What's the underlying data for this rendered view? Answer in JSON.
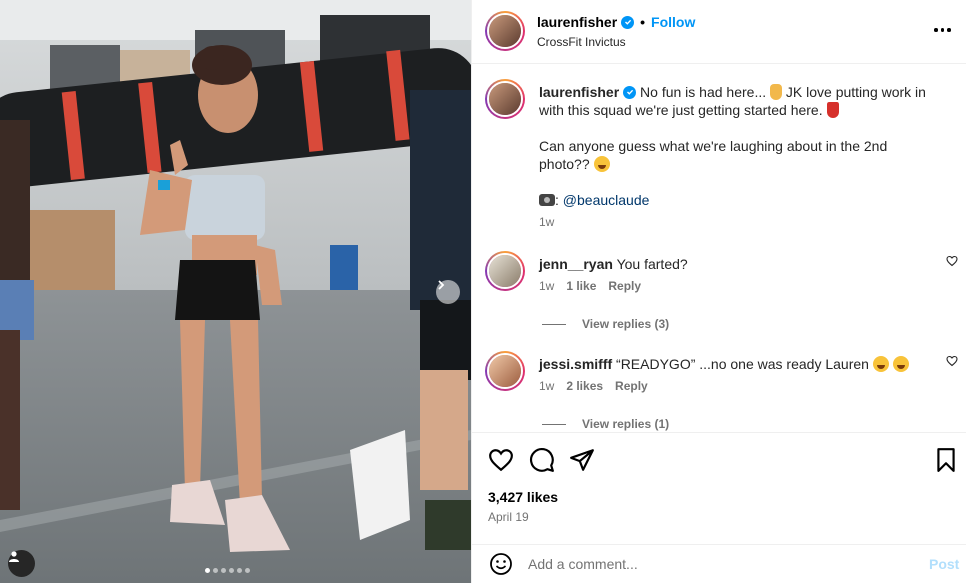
{
  "post": {
    "username": "laurenfisher",
    "follow_label": "Follow",
    "location": "CrossFit Invictus",
    "dot": "•",
    "carousel": {
      "slide_count": 6,
      "active_index": 0
    }
  },
  "caption": {
    "username": "laurenfisher",
    "line1": "No fun is had here... ",
    "line1b": " JK love putting work in with this squad we're just getting started here. ",
    "line2": "Can anyone guess what we're laughing about in the 2nd photo?? ",
    "credit_prefix": ": ",
    "credit_handle": "@beauclaude",
    "time": "1w"
  },
  "comments": [
    {
      "username": "jenn__ryan",
      "text": "You farted?",
      "time": "1w",
      "likes": "1 like",
      "reply_label": "Reply",
      "view_replies": "View replies (3)"
    },
    {
      "username": "jessi.smifff",
      "text": "“READYGO” ...no one was ready Lauren ",
      "time": "1w",
      "likes": "2 likes",
      "reply_label": "Reply",
      "view_replies": "View replies (1)"
    }
  ],
  "stats": {
    "likes": "3,427 likes",
    "date": "April 19"
  },
  "composer": {
    "placeholder": "Add a comment...",
    "post_label": "Post"
  },
  "icons": {
    "verified": "verified-badge-icon",
    "more": "more-options-icon",
    "like": "heart-icon",
    "comment": "comment-icon",
    "share": "share-icon",
    "save": "bookmark-icon",
    "emoji": "emoji-icon",
    "next": "chevron-right-icon",
    "tags": "user-tag-icon"
  },
  "colors": {
    "accent": "#0095f6",
    "text": "#262626",
    "muted": "#737373",
    "post_disabled": "#b2dffc"
  }
}
